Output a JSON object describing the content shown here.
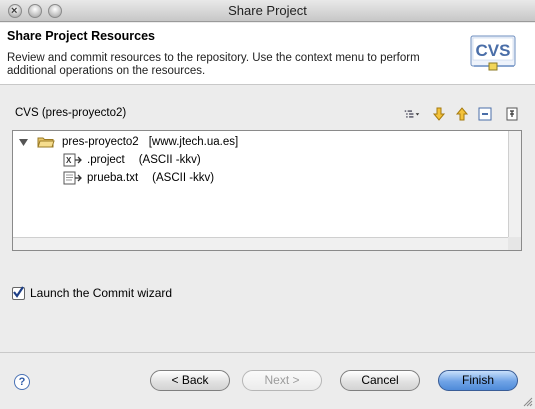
{
  "window": {
    "title": "Share Project"
  },
  "banner": {
    "title": "Share Project Resources",
    "description": "Review and commit resources to the repository. Use the context menu to perform additional operations on the resources.",
    "logo_text": "CVS"
  },
  "section": {
    "label": "CVS (pres-proyecto2)"
  },
  "toolbar": {
    "icons": [
      "presentation-mode-icon",
      "next-change-icon",
      "previous-change-icon",
      "collapse-all-icon",
      "pin-icon"
    ]
  },
  "tree": {
    "root": {
      "name": "pres-proyecto2",
      "location": "[www.jtech.ua.es]"
    },
    "children": [
      {
        "name": ".project",
        "mode": "(ASCII -kkv)"
      },
      {
        "name": "prueba.txt",
        "mode": "(ASCII -kkv)"
      }
    ]
  },
  "launch_commit": {
    "label": "Launch the Commit wizard",
    "checked": true
  },
  "buttons": {
    "back": "< Back",
    "next": "Next >",
    "cancel": "Cancel",
    "finish": "Finish"
  },
  "colors": {
    "accent": "#4f8bd9",
    "folder": "#e8c66a"
  }
}
